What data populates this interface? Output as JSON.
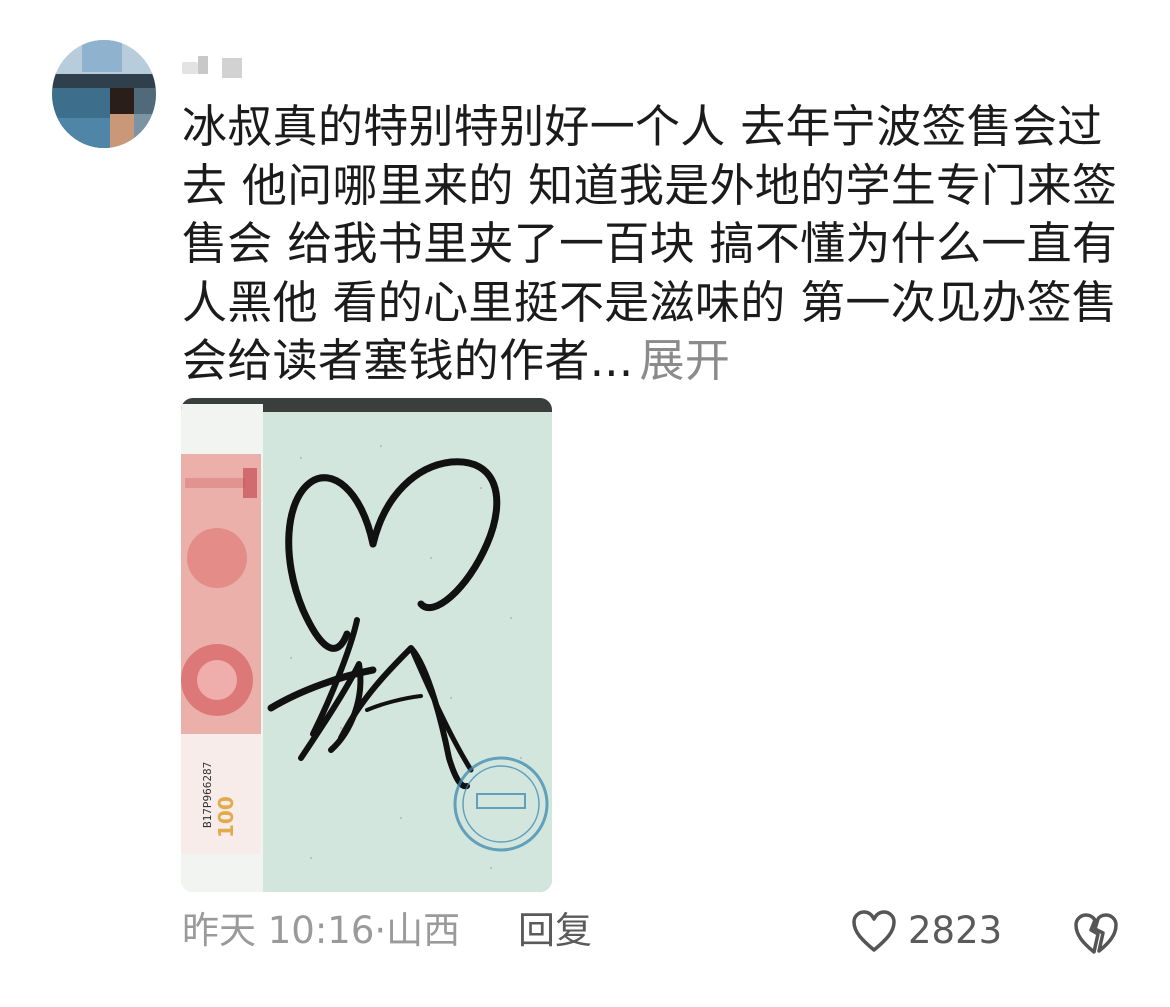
{
  "comment": {
    "text": "冰叔真的特别特别好一个人 去年宁波签售会过去 他问哪里来的 知道我是外地的学生专门来签售会 给我书里夹了一百块 搞不懂为什么一直有人黑他 看的心里挺不是滋味的 第一次见办签售会给读者塞钱的作者...",
    "expand_label": "展开"
  },
  "meta": {
    "time": "昨天 10:16",
    "separator": "·",
    "location": "山西",
    "reply_label": "回复"
  },
  "like": {
    "icon": "heart-outline-icon",
    "count": "2823"
  },
  "dislike": {
    "icon": "broken-heart-icon"
  },
  "photo": {
    "banknote_serial": "B17P966287"
  },
  "colors": {
    "text": "#1b1b1b",
    "muted": "#9a9a9a",
    "action": "#5a5a5a"
  }
}
